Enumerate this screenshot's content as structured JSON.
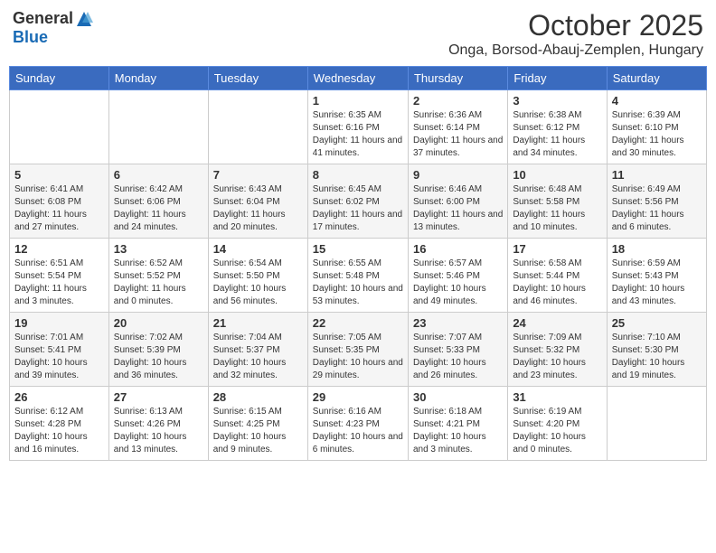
{
  "header": {
    "logo_general": "General",
    "logo_blue": "Blue",
    "month_title": "October 2025",
    "location": "Onga, Borsod-Abauj-Zemplen, Hungary"
  },
  "days_of_week": [
    "Sunday",
    "Monday",
    "Tuesday",
    "Wednesday",
    "Thursday",
    "Friday",
    "Saturday"
  ],
  "weeks": [
    [
      {
        "day": "",
        "info": ""
      },
      {
        "day": "",
        "info": ""
      },
      {
        "day": "",
        "info": ""
      },
      {
        "day": "1",
        "info": "Sunrise: 6:35 AM\nSunset: 6:16 PM\nDaylight: 11 hours and 41 minutes."
      },
      {
        "day": "2",
        "info": "Sunrise: 6:36 AM\nSunset: 6:14 PM\nDaylight: 11 hours and 37 minutes."
      },
      {
        "day": "3",
        "info": "Sunrise: 6:38 AM\nSunset: 6:12 PM\nDaylight: 11 hours and 34 minutes."
      },
      {
        "day": "4",
        "info": "Sunrise: 6:39 AM\nSunset: 6:10 PM\nDaylight: 11 hours and 30 minutes."
      }
    ],
    [
      {
        "day": "5",
        "info": "Sunrise: 6:41 AM\nSunset: 6:08 PM\nDaylight: 11 hours and 27 minutes."
      },
      {
        "day": "6",
        "info": "Sunrise: 6:42 AM\nSunset: 6:06 PM\nDaylight: 11 hours and 24 minutes."
      },
      {
        "day": "7",
        "info": "Sunrise: 6:43 AM\nSunset: 6:04 PM\nDaylight: 11 hours and 20 minutes."
      },
      {
        "day": "8",
        "info": "Sunrise: 6:45 AM\nSunset: 6:02 PM\nDaylight: 11 hours and 17 minutes."
      },
      {
        "day": "9",
        "info": "Sunrise: 6:46 AM\nSunset: 6:00 PM\nDaylight: 11 hours and 13 minutes."
      },
      {
        "day": "10",
        "info": "Sunrise: 6:48 AM\nSunset: 5:58 PM\nDaylight: 11 hours and 10 minutes."
      },
      {
        "day": "11",
        "info": "Sunrise: 6:49 AM\nSunset: 5:56 PM\nDaylight: 11 hours and 6 minutes."
      }
    ],
    [
      {
        "day": "12",
        "info": "Sunrise: 6:51 AM\nSunset: 5:54 PM\nDaylight: 11 hours and 3 minutes."
      },
      {
        "day": "13",
        "info": "Sunrise: 6:52 AM\nSunset: 5:52 PM\nDaylight: 11 hours and 0 minutes."
      },
      {
        "day": "14",
        "info": "Sunrise: 6:54 AM\nSunset: 5:50 PM\nDaylight: 10 hours and 56 minutes."
      },
      {
        "day": "15",
        "info": "Sunrise: 6:55 AM\nSunset: 5:48 PM\nDaylight: 10 hours and 53 minutes."
      },
      {
        "day": "16",
        "info": "Sunrise: 6:57 AM\nSunset: 5:46 PM\nDaylight: 10 hours and 49 minutes."
      },
      {
        "day": "17",
        "info": "Sunrise: 6:58 AM\nSunset: 5:44 PM\nDaylight: 10 hours and 46 minutes."
      },
      {
        "day": "18",
        "info": "Sunrise: 6:59 AM\nSunset: 5:43 PM\nDaylight: 10 hours and 43 minutes."
      }
    ],
    [
      {
        "day": "19",
        "info": "Sunrise: 7:01 AM\nSunset: 5:41 PM\nDaylight: 10 hours and 39 minutes."
      },
      {
        "day": "20",
        "info": "Sunrise: 7:02 AM\nSunset: 5:39 PM\nDaylight: 10 hours and 36 minutes."
      },
      {
        "day": "21",
        "info": "Sunrise: 7:04 AM\nSunset: 5:37 PM\nDaylight: 10 hours and 32 minutes."
      },
      {
        "day": "22",
        "info": "Sunrise: 7:05 AM\nSunset: 5:35 PM\nDaylight: 10 hours and 29 minutes."
      },
      {
        "day": "23",
        "info": "Sunrise: 7:07 AM\nSunset: 5:33 PM\nDaylight: 10 hours and 26 minutes."
      },
      {
        "day": "24",
        "info": "Sunrise: 7:09 AM\nSunset: 5:32 PM\nDaylight: 10 hours and 23 minutes."
      },
      {
        "day": "25",
        "info": "Sunrise: 7:10 AM\nSunset: 5:30 PM\nDaylight: 10 hours and 19 minutes."
      }
    ],
    [
      {
        "day": "26",
        "info": "Sunrise: 6:12 AM\nSunset: 4:28 PM\nDaylight: 10 hours and 16 minutes."
      },
      {
        "day": "27",
        "info": "Sunrise: 6:13 AM\nSunset: 4:26 PM\nDaylight: 10 hours and 13 minutes."
      },
      {
        "day": "28",
        "info": "Sunrise: 6:15 AM\nSunset: 4:25 PM\nDaylight: 10 hours and 9 minutes."
      },
      {
        "day": "29",
        "info": "Sunrise: 6:16 AM\nSunset: 4:23 PM\nDaylight: 10 hours and 6 minutes."
      },
      {
        "day": "30",
        "info": "Sunrise: 6:18 AM\nSunset: 4:21 PM\nDaylight: 10 hours and 3 minutes."
      },
      {
        "day": "31",
        "info": "Sunrise: 6:19 AM\nSunset: 4:20 PM\nDaylight: 10 hours and 0 minutes."
      },
      {
        "day": "",
        "info": ""
      }
    ]
  ]
}
